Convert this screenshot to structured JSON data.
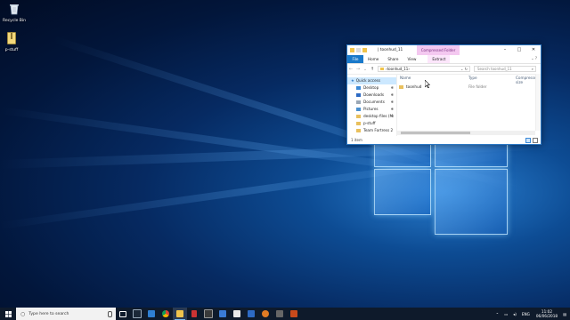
{
  "desktop": {
    "icons": [
      {
        "label": "Recycle Bin",
        "icon": "recycle-bin-icon"
      },
      {
        "label": "p-stuff",
        "icon": "zip-folder-icon"
      }
    ]
  },
  "explorer": {
    "title": "toonhud_11",
    "contextual_tab": "Compressed Folder Tools",
    "ribbon_tabs": [
      "File",
      "Home",
      "Share",
      "View",
      "Extract"
    ],
    "path": [
      "toonhud_11"
    ],
    "search_placeholder": "Search toonhud_11",
    "nav_items": [
      {
        "label": "Quick access",
        "icon": "star-icon",
        "pinned": false
      },
      {
        "label": "Desktop",
        "icon": "desktop-folder-icon",
        "pinned": true
      },
      {
        "label": "Downloads",
        "icon": "downloads-icon",
        "pinned": true
      },
      {
        "label": "Documents",
        "icon": "documents-icon",
        "pinned": true
      },
      {
        "label": "Pictures",
        "icon": "pictures-icon",
        "pinned": true
      },
      {
        "label": "desktop files (M:",
        "icon": "folder-icon",
        "pinned": true
      },
      {
        "label": "p-stuff",
        "icon": "folder-icon",
        "pinned": false
      },
      {
        "label": "Team Fortress 2",
        "icon": "folder-icon",
        "pinned": false
      }
    ],
    "columns": [
      "Name",
      "Type",
      "Compressed size"
    ],
    "files": [
      {
        "name": "toonhud",
        "type": "File folder"
      }
    ],
    "status": "1 item"
  },
  "taskbar": {
    "search_placeholder": "Type here to search",
    "apps": [
      {
        "name": "task-view",
        "color": "#ffffff"
      },
      {
        "name": "steam",
        "color": "#1b2838"
      },
      {
        "name": "edge",
        "color": "#2f7fd2"
      },
      {
        "name": "chrome",
        "color": "#3aa655"
      },
      {
        "name": "file-explorer",
        "color": "#f0c44c"
      },
      {
        "name": "app-6",
        "color": "#d33"
      },
      {
        "name": "app-7",
        "color": "#444"
      },
      {
        "name": "app-8",
        "color": "#3a7bd5"
      },
      {
        "name": "app-9",
        "color": "#e9e9e9"
      },
      {
        "name": "app-10",
        "color": "#2d6ac4"
      },
      {
        "name": "app-11",
        "color": "#e07b24"
      },
      {
        "name": "app-12",
        "color": "#666"
      },
      {
        "name": "app-13",
        "color": "#c84a1c"
      }
    ],
    "language": "ENG",
    "time": "11:02",
    "date": "06/06/2018"
  }
}
